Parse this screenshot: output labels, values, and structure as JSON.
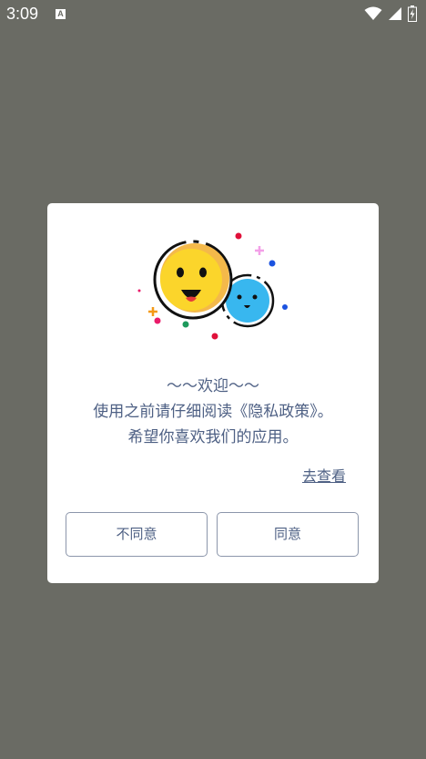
{
  "status_bar": {
    "time": "3:09",
    "notification_letter": "A",
    "icons": [
      "wifi-icon",
      "cell-signal-icon",
      "battery-charging-icon"
    ]
  },
  "dialog": {
    "illustration": "smiling-faces-illustration",
    "message_lines": [
      "～～欢迎～～",
      "使用之前请仔细阅读《隐私政策》。",
      "希望你喜欢我们的应用。"
    ],
    "view_link": "去查看",
    "disagree_label": "不同意",
    "agree_label": "同意"
  },
  "colors": {
    "overlay": "#6a6b64",
    "text": "#4e6084",
    "button_border": "#8c96ab"
  }
}
